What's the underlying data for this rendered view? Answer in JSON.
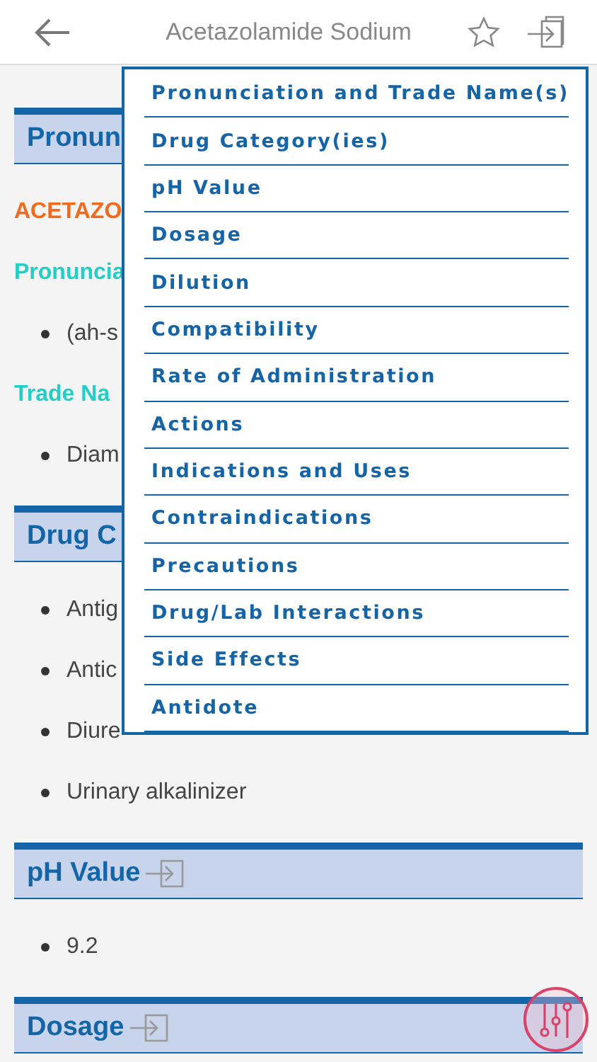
{
  "header": {
    "title": "Acetazolamide Sodium"
  },
  "sections": [
    {
      "heading": "Pronun",
      "jump_icon": false,
      "items": [
        {
          "kind": "drug_name",
          "text": "ACETAZO"
        },
        {
          "kind": "subheading",
          "text": "Pronuncia"
        },
        {
          "kind": "bullet",
          "text": "(ah-s"
        },
        {
          "kind": "subheading",
          "text": "Trade Na"
        },
        {
          "kind": "bullet",
          "text": "Diam"
        }
      ]
    },
    {
      "heading": "Drug C",
      "jump_icon": false,
      "items": [
        {
          "kind": "bullet",
          "text": "Antig"
        },
        {
          "kind": "bullet",
          "text": "Antic"
        },
        {
          "kind": "bullet",
          "text": "Diure"
        },
        {
          "kind": "bullet",
          "text": "Urinary alkalinizer"
        }
      ]
    },
    {
      "heading": "pH Value",
      "jump_icon": true,
      "items": [
        {
          "kind": "bullet",
          "text": "9.2"
        }
      ]
    },
    {
      "heading": "Dosage",
      "jump_icon": true
    }
  ],
  "menu": [
    "Pronunciation and Trade Name(s)",
    "Drug Category(ies)",
    "pH Value",
    "Dosage",
    "Dilution",
    "Compatibility",
    "Rate of Administration",
    "Actions",
    "Indications and Uses",
    "Contraindications",
    "Precautions",
    "Drug/Lab Interactions",
    "Side Effects",
    "Antidote"
  ]
}
